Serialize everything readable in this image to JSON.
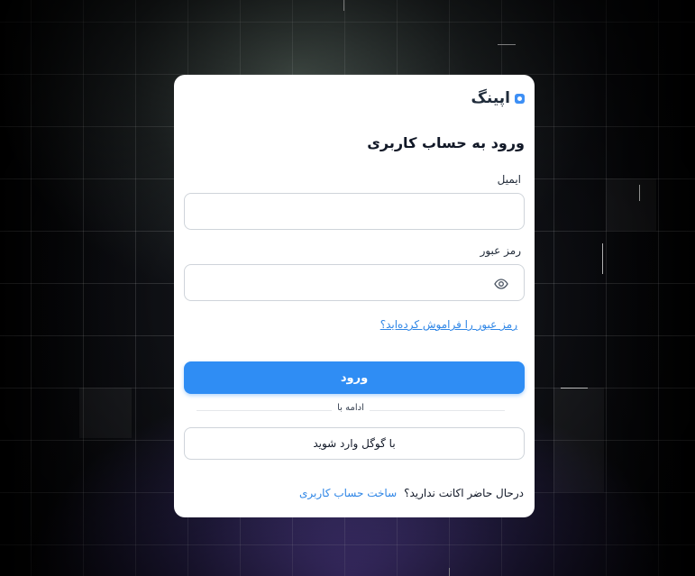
{
  "brand": {
    "name": "اپینگ",
    "accent_color": "#2f8df4"
  },
  "login": {
    "title": "ورود به حساب کاربری",
    "email_label": "ایمیل",
    "email_value": "",
    "password_label": "رمز عبور",
    "password_value": "",
    "forgot_password": "رمز عبور را فراموش کرده‌اید؟",
    "submit_label": "ورود",
    "divider_text": "ادامه با",
    "google_label": "با گوگل وارد شوید",
    "no_account_text": "درحال حاضر اکانت ندارید؟",
    "signup_link": "ساخت حساب کاربری"
  },
  "icons": {
    "logo": "logo-icon",
    "password_toggle": "eye-icon"
  }
}
